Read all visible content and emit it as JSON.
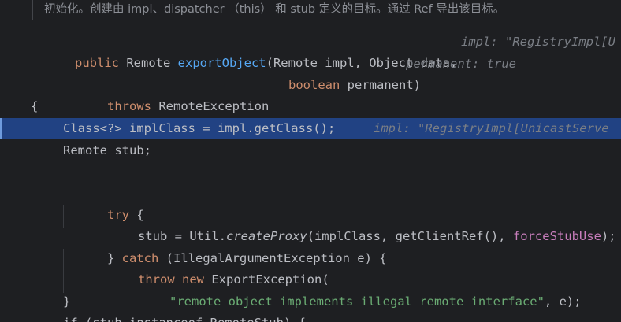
{
  "doc_comment": "初始化。创建由 impl、dispatcher （this） 和 stub 定义的目标。通过 Ref 导出该目标。",
  "lines": {
    "l1": {
      "kw_public": "public",
      "t1": " Remote ",
      "method": "exportObject",
      "t2": "(Remote impl, Object data,",
      "hint": "impl: \"RegistryImpl[U"
    },
    "l2": {
      "kw_boolean": "boolean",
      "t1": " permanent)",
      "hint": "permanent: true"
    },
    "l3": {
      "kw_throws": "throws",
      "t1": " RemoteException"
    },
    "l4": {
      "t1": "{"
    },
    "l5": {
      "t1": "Class<?> implClass = impl.getClass();",
      "hint": "impl: \"RegistryImpl[UnicastServe"
    },
    "l6": {
      "t1": "Remote stub;"
    },
    "l7": {
      "kw_try": "try",
      "t1": " {"
    },
    "l8": {
      "t1": "stub = Util.",
      "call": "createProxy",
      "t2": "(implClass, getClientRef(), ",
      "field": "forceStubUse",
      "t3": ");"
    },
    "l9": {
      "t1": "} ",
      "kw_catch": "catch",
      "t2": " (IllegalArgumentException e) {"
    },
    "l10": {
      "kw_throw": "throw",
      "kw_new": "new",
      "t1": " ExportException("
    },
    "l11": {
      "str": "\"remote object implements illegal remote interface\"",
      "t1": ", e);"
    },
    "l12": {
      "t1": "}"
    },
    "l13": {
      "t1": "if (stub instanceof RemoteStub) {"
    }
  }
}
